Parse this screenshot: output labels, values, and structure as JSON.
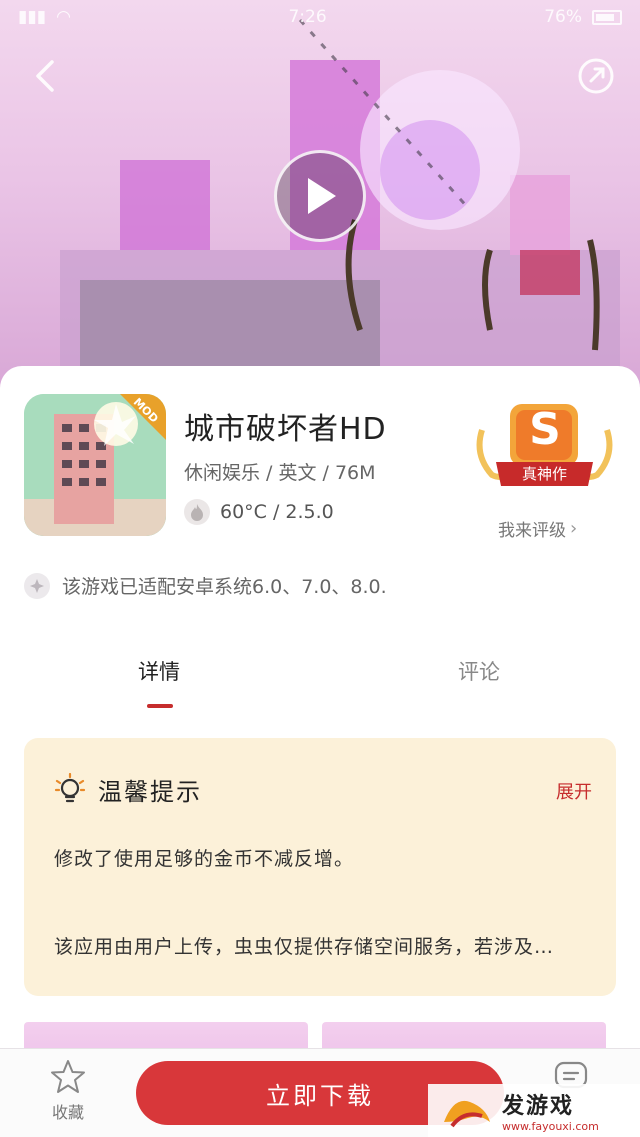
{
  "status": {
    "time": "7:26",
    "battery": "76%"
  },
  "app": {
    "title": "城市破坏者HD",
    "meta": "休闲娱乐 / 英文 / 76M",
    "heat_version": "60°C / 2.5.0",
    "icon_badge": "MOD"
  },
  "rating": {
    "grade": "S",
    "badge_label": "真神作",
    "rate_link": "我来评级"
  },
  "compat": {
    "text": "该游戏已适配安卓系统6.0、7.0、8.0."
  },
  "tabs": [
    {
      "label": "详情"
    },
    {
      "label": "评论"
    }
  ],
  "tips": {
    "title": "温馨提示",
    "expand": "展开",
    "line1": "修改了使用足够的金币不减反增。",
    "line2": "该应用由用户上传，虫虫仅提供存储空间服务，若涉及…"
  },
  "bottombar": {
    "favorite_label": "收藏",
    "download_label": "立即下载"
  },
  "watermark": {
    "title": "发游戏",
    "url": "www.fayouxi.com"
  },
  "colors": {
    "accent": "#d8373a",
    "tips_bg": "#fcf1d9",
    "hero_bg": "#eac4e6"
  }
}
